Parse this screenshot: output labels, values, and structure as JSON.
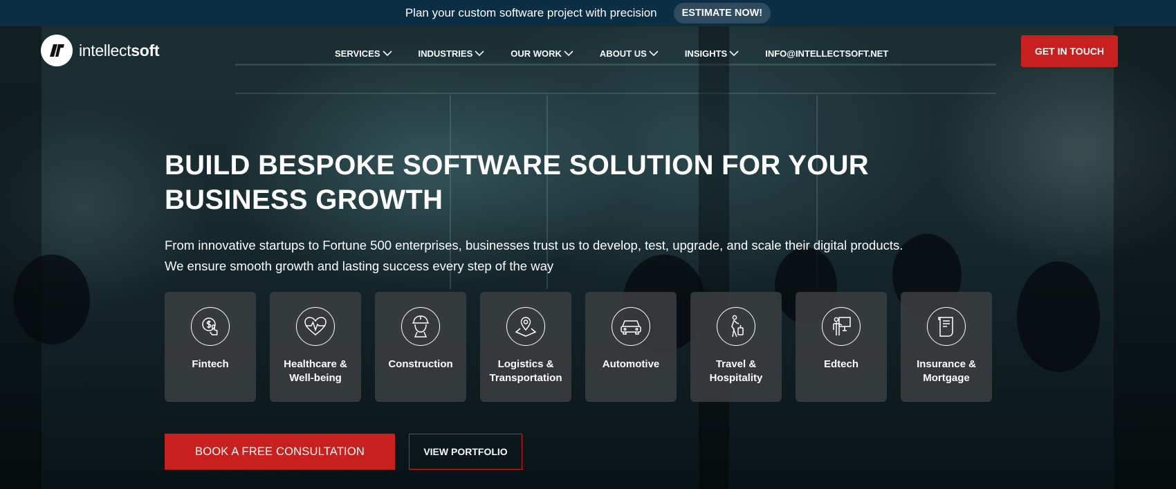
{
  "promo": {
    "text": "Plan your custom software project with precision",
    "button_label": "ESTIMATE NOW!"
  },
  "header": {
    "logo_light": "intellect",
    "logo_bold": "soft",
    "nav": [
      {
        "label": "SERVICES",
        "has_dropdown": true
      },
      {
        "label": "INDUSTRIES",
        "has_dropdown": true
      },
      {
        "label": "OUR WORK",
        "has_dropdown": true
      },
      {
        "label": "ABOUT US",
        "has_dropdown": true
      },
      {
        "label": "INSIGHTS",
        "has_dropdown": true
      },
      {
        "label": "INFO@INTELLECTSOFT.NET",
        "has_dropdown": false
      }
    ],
    "cta_label": "GET IN TOUCH"
  },
  "hero": {
    "headline_line1": "BUILD BESPOKE SOFTWARE SOLUTION FOR YOUR",
    "headline_line2": "BUSINESS GROWTH",
    "subtext_line1": "From innovative startups to Fortune 500 enterprises, businesses trust us to develop, test, upgrade, and scale their digital products.",
    "subtext_line2": "We ensure smooth growth and lasting success every step of the way"
  },
  "industries": [
    {
      "label": "Fintech",
      "icon": "fintech-icon"
    },
    {
      "label": "Healthcare &\nWell-being",
      "icon": "heart-pulse-icon"
    },
    {
      "label": "Construction",
      "icon": "hard-hat-worker-icon"
    },
    {
      "label": "Logistics &\nTransportation",
      "icon": "location-pin-icon"
    },
    {
      "label": "Automotive",
      "icon": "car-icon"
    },
    {
      "label": "Travel &\nHospitality",
      "icon": "traveler-luggage-icon"
    },
    {
      "label": "Edtech",
      "icon": "teacher-board-icon"
    },
    {
      "label": "Insurance &\nMortgage",
      "icon": "document-icon"
    }
  ],
  "actions": {
    "primary_label": "BOOK A FREE CONSULTATION",
    "secondary_label": "VIEW PORTFOLIO"
  },
  "colors": {
    "promo_bg": "#0b2e45",
    "accent_red": "#c8201f",
    "card_bg": "#3a3e40"
  }
}
